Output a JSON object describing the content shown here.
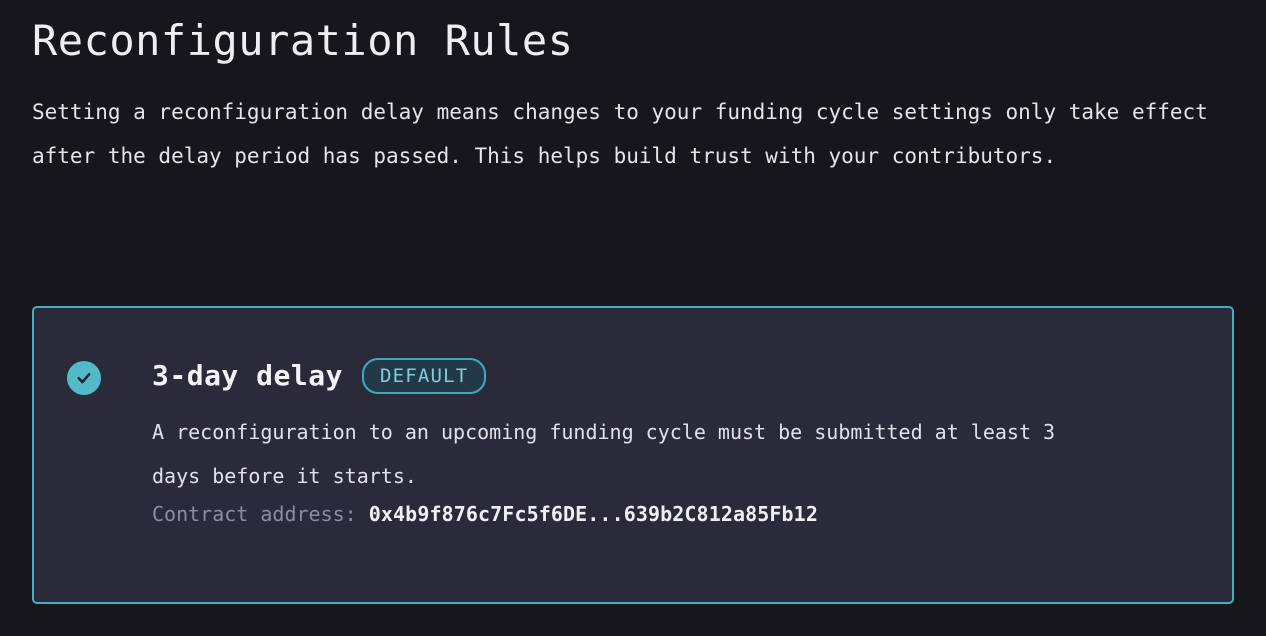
{
  "page": {
    "title": "Reconfiguration Rules",
    "intro": "Setting a reconfiguration delay means changes to your funding cycle settings only take effect after the delay period has passed. This helps build trust with your contributors."
  },
  "option_card": {
    "selected": true,
    "check_icon": "check-circle-icon",
    "title": "3-day delay",
    "badge_label": "DEFAULT",
    "description": "A reconfiguration to an upcoming funding cycle must be submitted at least 3 days before it starts.",
    "contract_label": "Contract address:",
    "contract_address": "0x4b9f876c7Fc5f6DE...639b2C812a85Fb12"
  },
  "colors": {
    "background": "#16161b",
    "card_background": "#2a2a3b",
    "card_border": "#45aec2",
    "accent_teal": "#52b9c6",
    "badge_text": "#7ecfdc",
    "badge_border": "#3fa9bd",
    "badge_background": "#23394a",
    "heading_text": "#eceef3",
    "body_text": "#e3e5ec",
    "muted_text": "#8c8ca2"
  }
}
